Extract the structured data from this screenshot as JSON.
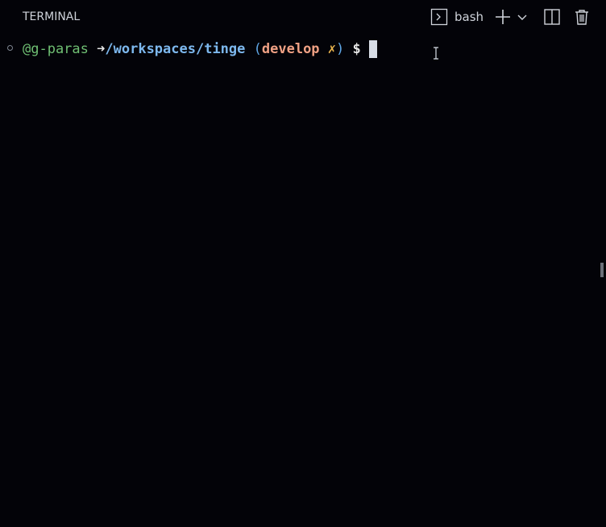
{
  "panel": {
    "title": "TERMINAL",
    "shell_name": "bash",
    "icons": {
      "shell": "terminal-icon",
      "new": "plus-icon",
      "dropdown": "chevron-down-icon",
      "split": "split-editor-icon",
      "kill": "trash-icon"
    }
  },
  "prompt": {
    "user": "@g-paras",
    "arrow": "➜",
    "path": "/workspaces/tinge",
    "open_paren": "(",
    "branch": "develop",
    "dirty": "✗",
    "close_paren": ")",
    "dollar": "$"
  },
  "colors": {
    "background": "#030308",
    "user": "#6fbf73",
    "path": "#7db8ee",
    "branch": "#f0a184",
    "dirty": "#e8b34c",
    "paren": "#5fa6e6"
  }
}
